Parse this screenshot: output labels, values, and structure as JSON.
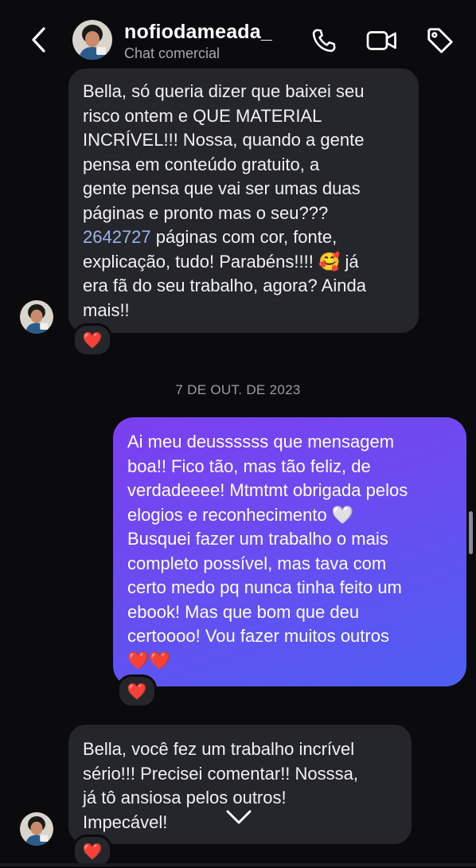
{
  "header": {
    "username": "nofiodameada_",
    "subtitle": "Chat comercial",
    "icons": {
      "back": "chevron-left-icon",
      "call": "phone-icon",
      "video": "video-camera-icon",
      "label": "tag-icon"
    }
  },
  "messages": {
    "m1": {
      "lines": [
        "Bella, só queria dizer que baixei seu",
        "risco ontem e QUE MATERIAL",
        "INCRÍVEL!!! Nossa, quando a gente",
        "pensa em conteúdo gratuito, a",
        "gente pensa que vai ser umas duas",
        "páginas e pronto mas o seu???"
      ],
      "link_number": "2642727",
      "line7_rest": " páginas com cor, fonte,",
      "line8": "explicação, tudo! Parabéns!!!! ",
      "emoji": "🥰",
      "line8_end": " já",
      "line9": "era fã do seu trabalho, agora? Ainda",
      "line10": "mais!!",
      "reaction": "❤️"
    },
    "date_separator": "7 DE OUT. DE 2023",
    "m2": {
      "lines": [
        "Ai meu deussssss que mensagem",
        "boa!! Fico tão, mas tão feliz, de",
        "verdadeeee! Mtmtmt obrigada pelos"
      ],
      "line4": "elogios e reconhecimento ",
      "line4_emoji": "🤍",
      "lines_b": [
        "Busquei fazer um trabalho o mais",
        "completo possível, mas tava com",
        "certo medo pq nunca tinha feito um",
        "ebook! Mas que bom que deu",
        "certoooo! Vou fazer muitos outros"
      ],
      "hearts": "❤️❤️",
      "reaction": "❤️"
    },
    "m3": {
      "lines": [
        "Bella, você fez um trabalho incrível",
        "sério!!! Precisei comentar!! Nosssa,",
        "já tô ansiosa pelos outros!",
        "Impecável!"
      ],
      "reaction": "❤️"
    }
  },
  "colors": {
    "background": "#0b0b0d",
    "incoming_bubble": "#25262b",
    "outgoing_gradient_start": "#7c3ff0",
    "outgoing_gradient_end": "#4d5ef2",
    "link": "#9ab4e8"
  }
}
